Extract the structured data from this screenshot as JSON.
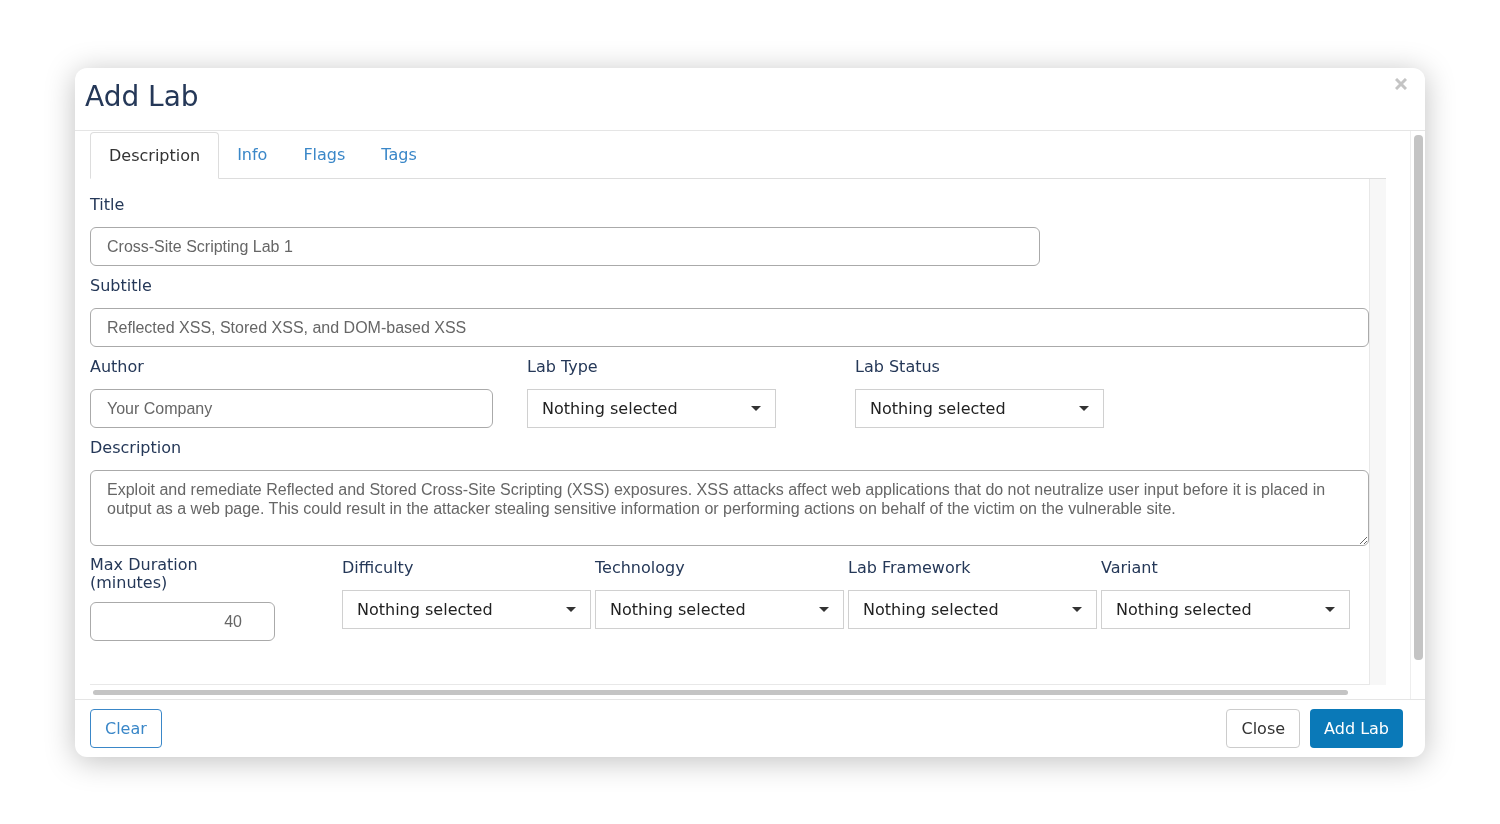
{
  "window": {
    "title": "Add Lab"
  },
  "tabs": [
    {
      "label": "Description",
      "selected": true
    },
    {
      "label": "Info",
      "selected": false
    },
    {
      "label": "Flags",
      "selected": false
    },
    {
      "label": "Tags",
      "selected": false
    }
  ],
  "title": {
    "label": "Title",
    "value": "Cross-Site Scripting Lab 1"
  },
  "subtitle": {
    "label": "Subtitle",
    "value": "Reflected XSS, Stored XSS, and DOM-based XSS"
  },
  "author": {
    "label": "Author",
    "value": "Your Company"
  },
  "lab_type": {
    "label": "Lab Type",
    "value": "Nothing selected"
  },
  "lab_status": {
    "label": "Lab Status",
    "value": "Nothing selected"
  },
  "description": {
    "label": "Description",
    "value": "Exploit and remediate Reflected and Stored Cross-Site Scripting (XSS) exposures. XSS attacks affect web applications that do not neutralize user input before it is placed in output as a web page. This could result in the attacker stealing sensitive information or performing actions on behalf of the victim on the vulnerable site."
  },
  "max_duration": {
    "label": "Max Duration (minutes)",
    "value": "40"
  },
  "selects": [
    {
      "label": "Difficulty",
      "value": "Nothing selected"
    },
    {
      "label": "Technology",
      "value": "Nothing selected"
    },
    {
      "label": "Lab Framework",
      "value": "Nothing selected"
    },
    {
      "label": "Variant",
      "value": "Nothing selected"
    }
  ],
  "buttons": {
    "clear": "Clear",
    "close": "Close",
    "add": "Add Lab"
  }
}
